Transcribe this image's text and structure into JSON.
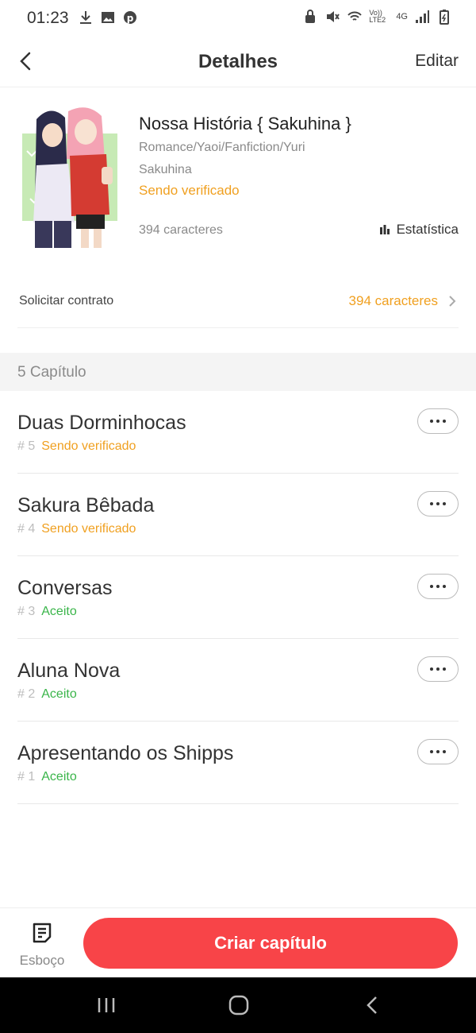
{
  "status_bar": {
    "time": "01:23",
    "network_label": "4G",
    "volte_label": "Vo)) LTE2"
  },
  "header": {
    "title": "Detalhes",
    "edit_label": "Editar"
  },
  "book": {
    "title": "Nossa História { Sakuhina }",
    "genres": "Romance/Yaoi/Fanfiction/Yuri",
    "tags": "Sakuhina",
    "status": "Sendo verificado",
    "characters": "394 caracteres",
    "stats_label": "Estatística"
  },
  "contract": {
    "label": "Solicitar contrato",
    "value": "394 caracteres"
  },
  "section": {
    "title": "5 Capítulo"
  },
  "chapters": [
    {
      "title": "Duas Dorminhocas",
      "number": "# 5",
      "status": "Sendo verificado"
    },
    {
      "title": "Sakura Bêbada",
      "number": "# 4",
      "status": "Sendo verificado"
    },
    {
      "title": "Conversas",
      "number": "# 3",
      "status": "Aceito"
    },
    {
      "title": "Aluna Nova",
      "number": "# 2",
      "status": "Aceito"
    },
    {
      "title": "Apresentando os Shipps",
      "number": "# 1",
      "status": "Aceito"
    }
  ],
  "bottom": {
    "draft_label": "Esboço",
    "create_label": "Criar capítulo"
  },
  "colors": {
    "accent_red": "#f84448",
    "pending_orange": "#f0a020",
    "accepted_green": "#3ab54a"
  }
}
